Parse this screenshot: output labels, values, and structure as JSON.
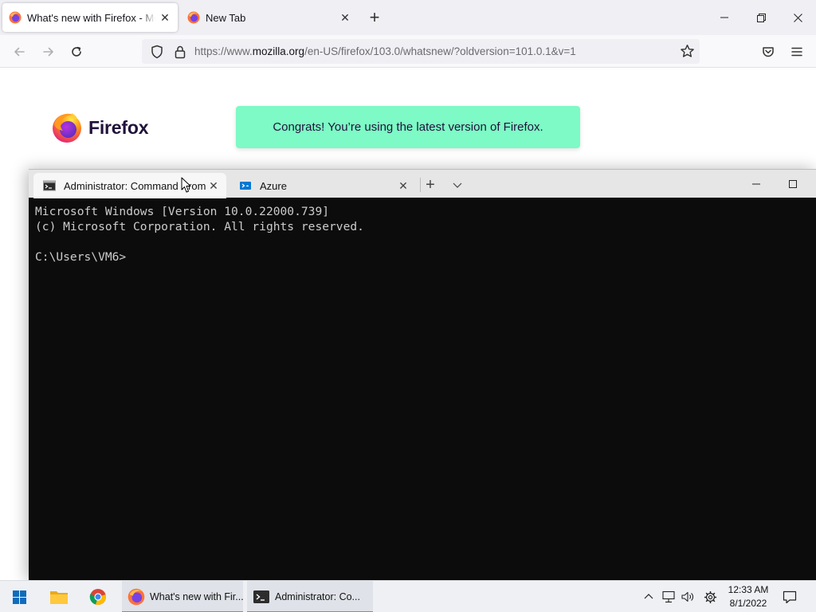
{
  "firefox": {
    "tabs": [
      {
        "title": "What's new with Firefox - More"
      },
      {
        "title": "New Tab"
      }
    ],
    "url": {
      "prefix": "https://www.",
      "domain": "mozilla.org",
      "path": "/en-US/firefox/103.0/whatsnew/?oldversion=101.0.1&v=1"
    },
    "page": {
      "logo_text": "Firefox",
      "congrats": "Congrats! You’re using the latest version of Firefox."
    }
  },
  "terminal": {
    "tabs": [
      {
        "title": "Administrator: Command Prompt"
      },
      {
        "title": "Azure"
      }
    ],
    "lines": [
      "Microsoft Windows [Version 10.0.22000.739]",
      "(c) Microsoft Corporation. All rights reserved.",
      "",
      "C:\\Users\\VM6>"
    ]
  },
  "taskbar": {
    "apps": [
      {
        "label": "What's new with Fir..."
      },
      {
        "label": "Administrator: Co..."
      }
    ],
    "time": "12:33 AM",
    "date": "8/1/2022"
  },
  "colors": {
    "congrats_bg": "#7dfac5",
    "terminal_bg": "#0c0c0c",
    "terminal_fg": "#cccccc"
  }
}
